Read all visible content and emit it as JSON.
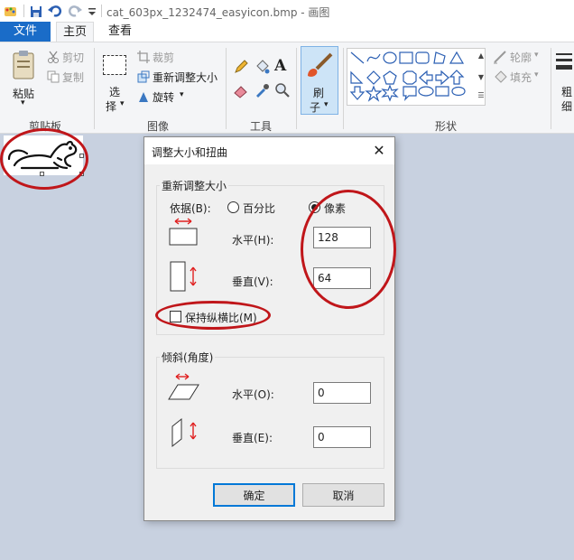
{
  "window": {
    "title": "cat_603px_1232474_easyicon.bmp - 画图"
  },
  "tabs": [
    {
      "label": "文件",
      "selected": false
    },
    {
      "label": "主页",
      "selected": true
    },
    {
      "label": "查看",
      "selected": false
    }
  ],
  "ribbon": {
    "clipboard": {
      "paste_label": "粘贴",
      "cut_label": "剪切",
      "copy_label": "复制",
      "group_label": "剪贴板"
    },
    "image": {
      "select_label_1": "选",
      "select_label_2": "择",
      "crop_label": "裁剪",
      "resize_label": "重新调整大小",
      "rotate_label": "旋转",
      "group_label": "图像"
    },
    "tools": {
      "text_tool_glyph": "A",
      "group_label": "工具"
    },
    "brush": {
      "label_1": "刷",
      "label_2": "子"
    },
    "shapes": {
      "outline_label": "轮廓",
      "fill_label": "填充",
      "group_label": "形状"
    },
    "size": {
      "label_1": "粗",
      "label_2": "细"
    }
  },
  "dialog": {
    "title": "调整大小和扭曲",
    "close_glyph": "✕",
    "resize_section": {
      "legend": "重新调整大小",
      "by_label": "依据(B):",
      "percent_label": "百分比",
      "pixels_label": "像素",
      "selected_unit": "pixels",
      "horizontal_label": "水平(H):",
      "horizontal_value": "128",
      "vertical_label": "垂直(V):",
      "vertical_value": "64",
      "keep_ratio_label": "保持纵横比(M)",
      "keep_ratio_checked": false
    },
    "skew_section": {
      "legend": "倾斜(角度)",
      "horizontal_label": "水平(O):",
      "horizontal_value": "0",
      "vertical_label": "垂直(E):",
      "vertical_value": "0"
    },
    "ok_label": "确定",
    "cancel_label": "取消"
  },
  "colors": {
    "accent": "#1a6cc8",
    "annotation": "#c0161a",
    "canvas_bg": "#c8d1e0"
  }
}
